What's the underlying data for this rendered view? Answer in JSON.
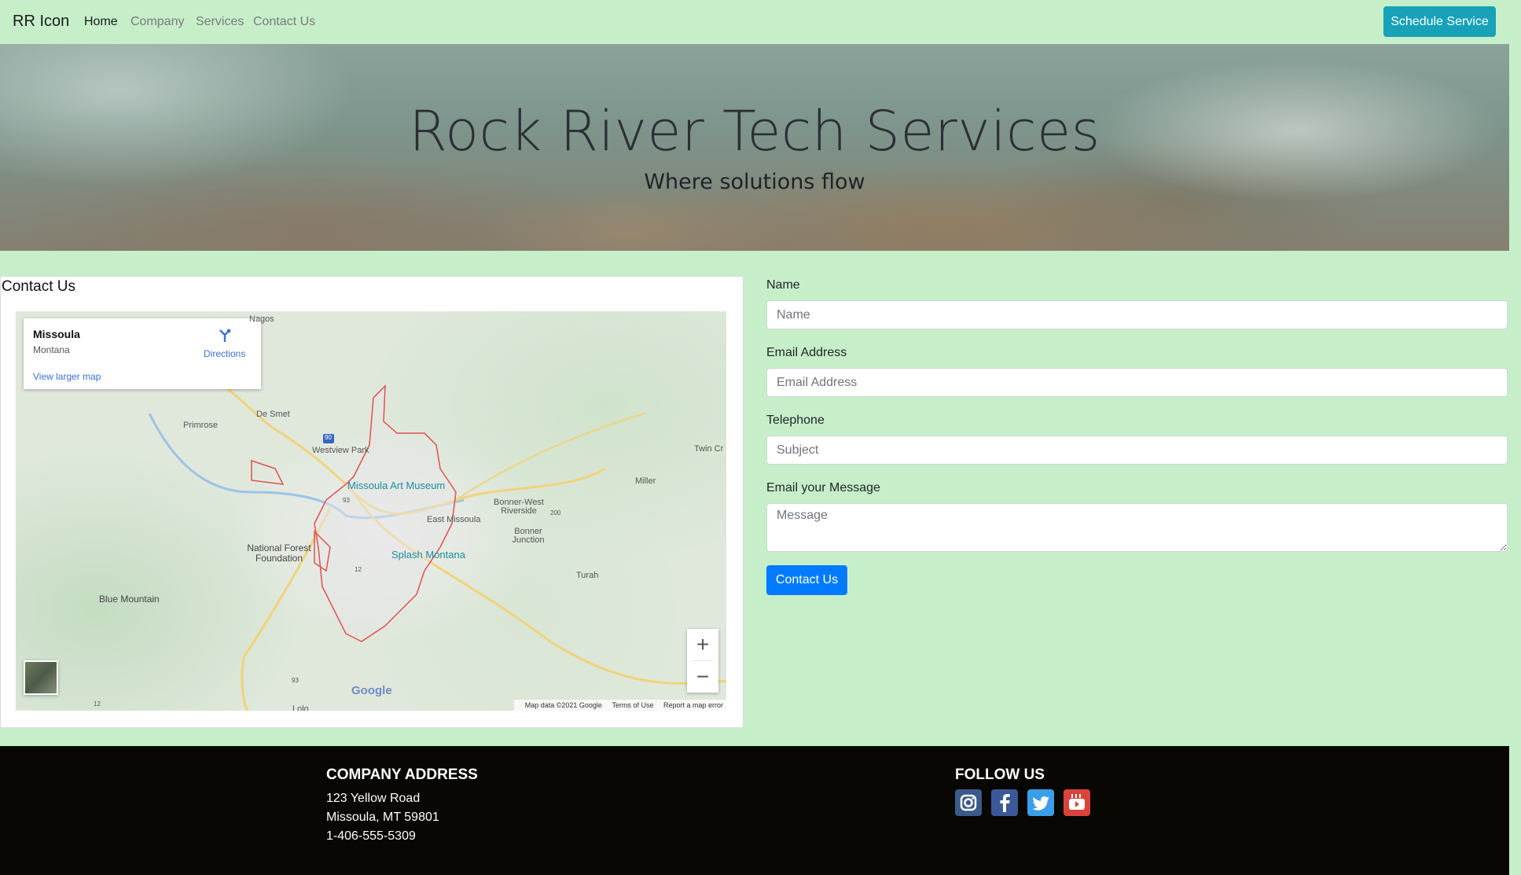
{
  "nav": {
    "brand": "RR Icon",
    "links": [
      "Home",
      "Company",
      "Services",
      "Contact Us"
    ],
    "cta": "Schedule Service"
  },
  "hero": {
    "title": "Rock River Tech Services",
    "subtitle": "Where solutions flow"
  },
  "contact": {
    "heading": "Contact Us",
    "map": {
      "infobox": {
        "city": "Missoula",
        "state": "Montana",
        "directions": "Directions",
        "larger_map": "View larger map"
      },
      "labels": [
        "Nagos",
        "De Smet",
        "Primrose",
        "Westview Park",
        "Twin Cr",
        "Miller",
        "Missoula Art Museum",
        "Bonner-West Riverside",
        "East Missoula",
        "Bonner Junction",
        "National Forest Foundation",
        "Splash Montana",
        "Blue Mountain",
        "Turah",
        "Lolo"
      ],
      "route_shields": [
        "90",
        "93",
        "12",
        "200",
        "93",
        "12"
      ],
      "zoom_in": "+",
      "zoom_out": "−",
      "logo": "Google",
      "attribution": [
        "Map data ©2021 Google",
        "Terms of Use",
        "Report a map error"
      ]
    }
  },
  "form": {
    "name_label": "Name",
    "name_placeholder": "Name",
    "email_label": "Email Address",
    "email_placeholder": "Email Address",
    "phone_label": "Telephone",
    "phone_placeholder": "Subject",
    "message_label": "Email your Message",
    "message_placeholder": "Message",
    "submit": "Contact Us"
  },
  "footer": {
    "address_heading": "COMPANY ADDRESS",
    "address_lines": [
      "123 Yellow Road",
      "Missoula, MT 59801",
      "1-406-555-5309"
    ],
    "follow_heading": "FOLLOW US",
    "social": [
      "instagram-icon",
      "facebook-icon",
      "twitter-icon",
      "youtube-icon"
    ]
  },
  "colors": {
    "page_bg": "#c6efc9",
    "cta": "#17a2b8",
    "primary": "#007bff",
    "footer_bg": "#080704"
  }
}
